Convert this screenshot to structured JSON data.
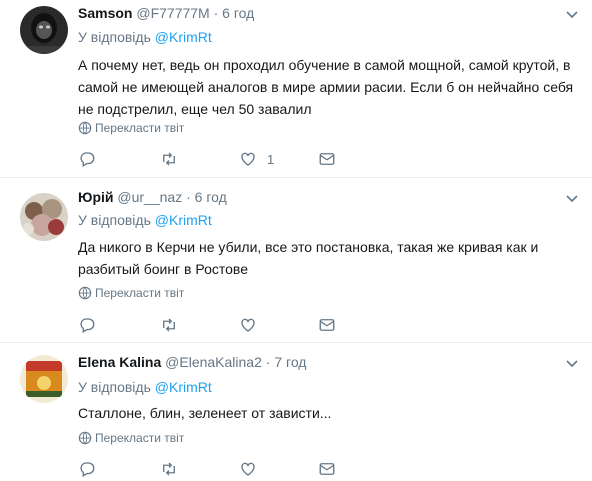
{
  "colors": {
    "accent": "#1da1f2",
    "muted": "#657786",
    "text": "#14171a",
    "divider": "#e6ecf0"
  },
  "tweets": [
    {
      "name": "Samson",
      "handle": "@F77777M",
      "dot": "·",
      "time": "6 год",
      "reply_prefix": "У відповідь",
      "mention": "@KrimRt",
      "text": "А почему нет, ведь он проходил обучение в самой мощной, самой крутой, в самой не имеющей аналогов в мире армии расии. Если б он нейчайно себя не подстрелил, еще чел 50 завалил",
      "translate": "Перекласти твіт",
      "like_count": "1"
    },
    {
      "name": "Юрій",
      "handle": "@ur__naz",
      "dot": "·",
      "time": "6 год",
      "reply_prefix": "У відповідь",
      "mention": "@KrimRt",
      "text": "Да никого в Керчи не убили, все это постановка, такая же кривая как и разбитый боинг в Ростове",
      "translate": "Перекласти твіт",
      "like_count": ""
    },
    {
      "name": "Elena Kalina",
      "handle": "@ElenaKalina2",
      "dot": "·",
      "time": "7 год",
      "reply_prefix": "У відповідь",
      "mention": "@KrimRt",
      "text": "Сталлоне, блин, зеленеет от зависти...",
      "translate": "Перекласти твіт",
      "like_count": ""
    }
  ],
  "icons": [
    "caret-down-icon",
    "globe-icon",
    "reply-icon",
    "retweet-icon",
    "like-icon",
    "message-icon"
  ]
}
